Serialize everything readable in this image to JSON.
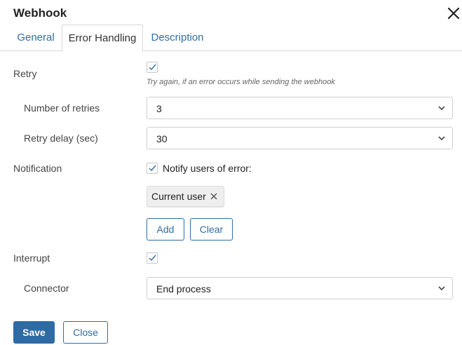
{
  "dialog": {
    "title": "Webhook",
    "close_icon": "close-icon"
  },
  "tabs": [
    {
      "label": "General",
      "active": false
    },
    {
      "label": "Error Handling",
      "active": true
    },
    {
      "label": "Description",
      "active": false
    }
  ],
  "retry": {
    "label": "Retry",
    "checked": true,
    "hint": "Try again, if an error occurs while sending the webhook",
    "number_of_retries": {
      "label": "Number of retries",
      "value": "3"
    },
    "retry_delay": {
      "label": "Retry delay (sec)",
      "value": "30"
    }
  },
  "notification": {
    "label": "Notification",
    "checked": true,
    "checkbox_label": "Notify users of error:",
    "users": [
      "Current user"
    ],
    "add_label": "Add",
    "clear_label": "Clear"
  },
  "interrupt": {
    "label": "Interrupt",
    "checked": true,
    "connector": {
      "label": "Connector",
      "value": "End process"
    }
  },
  "footer": {
    "save_label": "Save",
    "close_label": "Close"
  },
  "colors": {
    "accent": "#2e6aa3",
    "link": "#2f6da4",
    "border": "#d9d9d9"
  }
}
